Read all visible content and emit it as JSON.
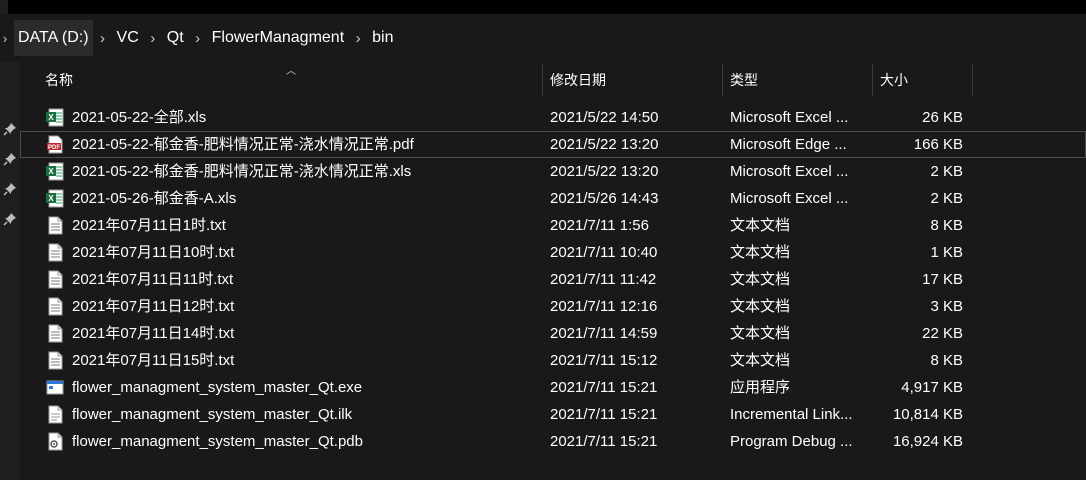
{
  "breadcrumb": {
    "items": [
      "DATA (D:)",
      "VC",
      "Qt",
      "FlowerManagment",
      "bin"
    ]
  },
  "columns": {
    "name": "名称",
    "date": "修改日期",
    "type": "类型",
    "size": "大小"
  },
  "files": [
    {
      "name": "2021-05-22-全部.xls",
      "date": "2021/5/22 14:50",
      "type": "Microsoft Excel ...",
      "size": "26 KB",
      "icon": "excel-icon"
    },
    {
      "name": "2021-05-22-郁金香-肥料情况正常-浇水情况正常.pdf",
      "date": "2021/5/22 13:20",
      "type": "Microsoft Edge ...",
      "size": "166 KB",
      "icon": "pdf-icon"
    },
    {
      "name": "2021-05-22-郁金香-肥料情况正常-浇水情况正常.xls",
      "date": "2021/5/22 13:20",
      "type": "Microsoft Excel ...",
      "size": "2 KB",
      "icon": "excel-icon"
    },
    {
      "name": "2021-05-26-郁金香-A.xls",
      "date": "2021/5/26 14:43",
      "type": "Microsoft Excel ...",
      "size": "2 KB",
      "icon": "excel-icon"
    },
    {
      "name": "2021年07月11日1时.txt",
      "date": "2021/7/11 1:56",
      "type": "文本文档",
      "size": "8 KB",
      "icon": "text-file-icon"
    },
    {
      "name": "2021年07月11日10时.txt",
      "date": "2021/7/11 10:40",
      "type": "文本文档",
      "size": "1 KB",
      "icon": "text-file-icon"
    },
    {
      "name": "2021年07月11日11时.txt",
      "date": "2021/7/11 11:42",
      "type": "文本文档",
      "size": "17 KB",
      "icon": "text-file-icon"
    },
    {
      "name": "2021年07月11日12时.txt",
      "date": "2021/7/11 12:16",
      "type": "文本文档",
      "size": "3 KB",
      "icon": "text-file-icon"
    },
    {
      "name": "2021年07月11日14时.txt",
      "date": "2021/7/11 14:59",
      "type": "文本文档",
      "size": "22 KB",
      "icon": "text-file-icon"
    },
    {
      "name": "2021年07月11日15时.txt",
      "date": "2021/7/11 15:12",
      "type": "文本文档",
      "size": "8 KB",
      "icon": "text-file-icon"
    },
    {
      "name": "flower_managment_system_master_Qt.exe",
      "date": "2021/7/11 15:21",
      "type": "应用程序",
      "size": "4,917 KB",
      "icon": "exe-icon"
    },
    {
      "name": "flower_managment_system_master_Qt.ilk",
      "date": "2021/7/11 15:21",
      "type": "Incremental Link...",
      "size": "10,814 KB",
      "icon": "ilk-file-icon"
    },
    {
      "name": "flower_managment_system_master_Qt.pdb",
      "date": "2021/7/11 15:21",
      "type": "Program Debug ...",
      "size": "16,924 KB",
      "icon": "pdb-file-icon"
    }
  ],
  "selected_row": 1,
  "colors": {
    "background": "#191919",
    "excel_green": "#1d6f42",
    "pdf_red": "#c1272d"
  }
}
